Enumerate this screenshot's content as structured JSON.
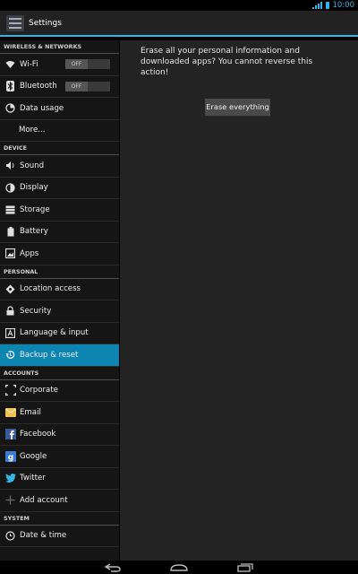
{
  "status": {
    "time": "10:00"
  },
  "actionbar": {
    "title": "Settings"
  },
  "sections": [
    {
      "header": "WIRELESS & NETWORKS",
      "items": [
        {
          "label": "Wi-Fi",
          "icon": "wifi-icon",
          "toggle": "OFF"
        },
        {
          "label": "Bluetooth",
          "icon": "bluetooth-icon",
          "toggle": "OFF"
        },
        {
          "label": "Data usage",
          "icon": "data-usage-icon"
        },
        {
          "label": "More...",
          "icon": ""
        }
      ]
    },
    {
      "header": "DEVICE",
      "items": [
        {
          "label": "Sound",
          "icon": "speaker-icon"
        },
        {
          "label": "Display",
          "icon": "display-icon"
        },
        {
          "label": "Storage",
          "icon": "storage-icon"
        },
        {
          "label": "Battery",
          "icon": "battery-icon"
        },
        {
          "label": "Apps",
          "icon": "apps-icon"
        }
      ]
    },
    {
      "header": "PERSONAL",
      "items": [
        {
          "label": "Location access",
          "icon": "location-icon"
        },
        {
          "label": "Security",
          "icon": "lock-icon"
        },
        {
          "label": "Language & input",
          "icon": "language-icon"
        },
        {
          "label": "Backup & reset",
          "icon": "backup-icon",
          "selected": true
        }
      ]
    },
    {
      "header": "ACCOUNTS",
      "items": [
        {
          "label": "Corporate",
          "icon": "corporate-icon"
        },
        {
          "label": "Email",
          "icon": "email-icon"
        },
        {
          "label": "Facebook",
          "icon": "facebook-icon"
        },
        {
          "label": "Google",
          "icon": "google-icon"
        },
        {
          "label": "Twitter",
          "icon": "twitter-icon"
        },
        {
          "label": "Add account",
          "icon": "plus-icon"
        }
      ]
    },
    {
      "header": "SYSTEM",
      "items": [
        {
          "label": "Date & time",
          "icon": "clock-icon"
        }
      ]
    }
  ],
  "content": {
    "message": "Erase all your personal information and downloaded apps? You cannot reverse this action!",
    "button_label": "Erase everything"
  },
  "colors": {
    "accent": "#33b5e5",
    "selected": "#0d85b0"
  }
}
